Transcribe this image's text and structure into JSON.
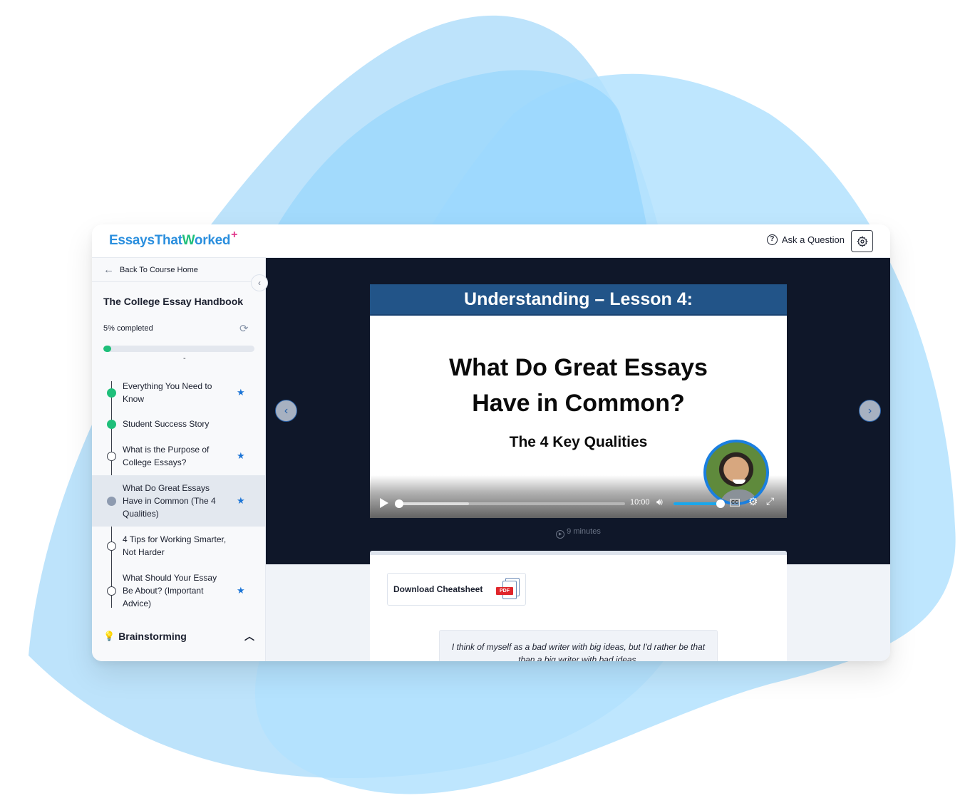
{
  "brand": {
    "logo_text_a": "EssaysThat",
    "logo_text_check": "W",
    "logo_text_b": "orked",
    "logo_plus": "+",
    "colors": {
      "logo_blue": "#2b8fde",
      "logo_green": "#1fbf7a",
      "logo_pink": "#e0358a",
      "accent_blue": "#1b74d6",
      "progress_green": "#1fbf7a",
      "stage_bg": "#0f1729",
      "slide_header": "#225488"
    }
  },
  "topbar": {
    "ask_icon": "question-circle-icon",
    "ask_label": "Ask a Question",
    "settings_icon": "gear-icon"
  },
  "sidebar": {
    "back_label": "Back To Course Home",
    "back_icon": "arrow-left-icon",
    "collapse_icon": "chevron-left-icon",
    "course_title": "The College Essay Handbook",
    "progress_label": "5% completed",
    "progress_percent": 5,
    "reset_icon": "refresh-icon",
    "divider_mark": "-",
    "lessons": [
      {
        "title": "Everything You Need to Know",
        "status": "completed",
        "starred": true
      },
      {
        "title": "Student Success Story",
        "status": "completed",
        "starred": false
      },
      {
        "title": "What is the Purpose of College Essays?",
        "status": "not-started",
        "starred": true
      },
      {
        "title": "What Do Great Essays Have in Common (The 4 Qualities)",
        "status": "current",
        "starred": true
      },
      {
        "title": "4 Tips for Working Smarter, Not Harder",
        "status": "not-started",
        "starred": false
      },
      {
        "title": "What Should Your Essay Be About? (Important Advice)",
        "status": "not-started",
        "starred": true
      }
    ],
    "star_glyph": "★",
    "section": {
      "icon": "lightbulb-icon",
      "label": "Brainstorming",
      "expanded": true
    }
  },
  "video": {
    "header": "Understanding – Lesson 4:",
    "title_line1": "What Do Great Essays",
    "title_line2": "Have in Common?",
    "subtitle": "The 4 Key Qualities",
    "time_label": "10:00",
    "played_fraction": 0.0,
    "buffered_fraction": 0.31,
    "volume_fraction": 1.0,
    "cc_label": "CC",
    "duration_label": "9 minutes"
  },
  "content": {
    "download_label": "Download Cheatsheet",
    "pdf_tag": "PDF",
    "quote": "I think of myself as a bad writer with big ideas, but I'd rather be that than a big writer with bad ideas."
  }
}
